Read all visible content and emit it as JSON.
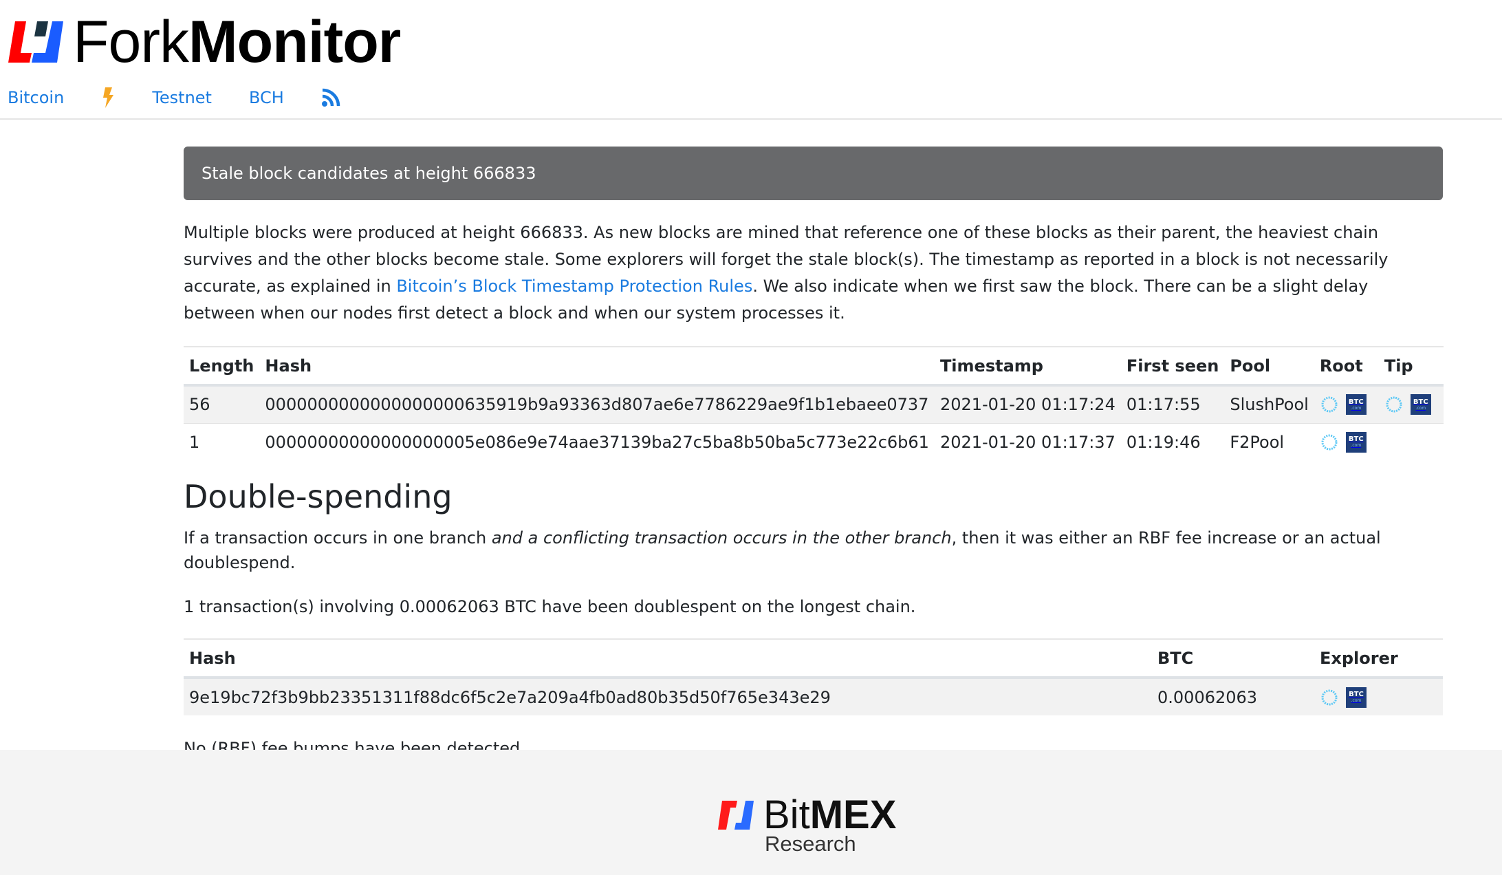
{
  "app": {
    "logo_light": "Fork",
    "logo_bold": "Monitor"
  },
  "nav": {
    "items": [
      {
        "label": "Bitcoin",
        "icon": null
      },
      {
        "label": "",
        "icon": "lightning-bolt-icon"
      },
      {
        "label": "Testnet",
        "icon": null
      },
      {
        "label": "BCH",
        "icon": null
      },
      {
        "label": "",
        "icon": "rss-feed-icon"
      }
    ],
    "link_color": "#1a7be0",
    "bolt_color": "#f5a623"
  },
  "banner": {
    "title": "Stale block candidates at height 666833"
  },
  "intro": {
    "text_before_link": "Multiple blocks were produced at height 666833. As new blocks are mined that reference one of these blocks as their parent, the heaviest chain survives and the other blocks become stale. Some explorers will forget the stale block(s). The timestamp as reported in a block is not necessarily accurate, as explained in ",
    "link_text": "Bitcoin’s Block Timestamp Protection Rules",
    "text_after_link": ". We also indicate when we first saw the block. There can be a slight delay between when our nodes first detect a block and when our system processes it."
  },
  "stale_table": {
    "headers": [
      "Length",
      "Hash",
      "Timestamp",
      "First seen",
      "Pool",
      "Root",
      "Tip"
    ],
    "rows": [
      {
        "length": "56",
        "hash": "0000000000000000000635919b9a93363d807ae6e7786229ae9f1b1ebaee0737",
        "timestamp": "2021-01-20 01:17:24",
        "first_seen": "01:17:55",
        "pool": "SlushPool",
        "root_explorers": [
          "blockstream-icon",
          "btc-com-icon"
        ],
        "tip_explorers": [
          "blockstream-icon",
          "btc-com-icon"
        ]
      },
      {
        "length": "1",
        "hash": "00000000000000000005e086e9e74aae37139ba27c5ba8b50ba5c773e22c6b61",
        "timestamp": "2021-01-20 01:17:37",
        "first_seen": "01:19:46",
        "pool": "F2Pool",
        "root_explorers": [
          "blockstream-icon",
          "btc-com-icon"
        ],
        "tip_explorers": []
      }
    ]
  },
  "double_spending": {
    "heading": "Double-spending",
    "para_before_em": "If a transaction occurs in one branch ",
    "para_em": "and a conflicting transaction occurs in the other branch",
    "para_after_em": ", then it was either an RBF fee increase or an actual doublespend.",
    "summary": "1 transaction(s) involving 0.00062063 BTC have been doublespent on the longest chain.",
    "table": {
      "headers": [
        "Hash",
        "BTC",
        "Explorer"
      ],
      "rows": [
        {
          "hash": "9e19bc72f3b9bb23351311f88dc6f5c2e7a209a4fb0ad80b35d50f765e343e29",
          "btc": "0.00062063",
          "explorers": [
            "blockstream-icon",
            "btc-com-icon"
          ]
        }
      ]
    },
    "rbf_note": "No (RBF) fee bumps have been detected"
  },
  "explorer_labels": {
    "btc_com_main": "BTC",
    "btc_com_sub": ".com"
  },
  "footer": {
    "brand_light": "Bit",
    "brand_bold": "MEX",
    "brand_sub": "Research"
  },
  "colors": {
    "banner_bg": "#68696b",
    "stripe_bg": "#f2f2f2",
    "footer_bg": "#f4f4f4",
    "logo_red": "#ff0000",
    "logo_blue": "#1a5cff",
    "logo_dark": "#1c3441",
    "btc_com_bg": "#1f3f7a",
    "blockstream_ring": "#5cc8f5"
  }
}
